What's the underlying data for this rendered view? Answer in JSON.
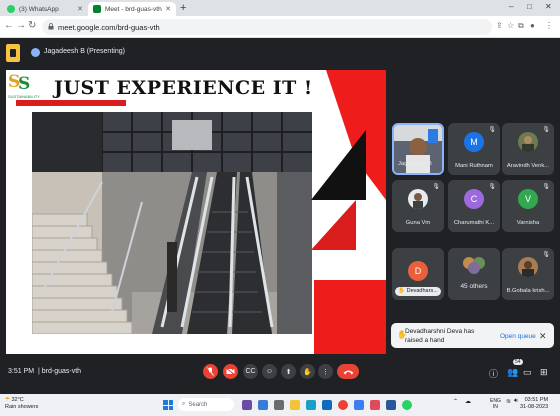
{
  "browser": {
    "tabs": [
      {
        "title": "(3) WhatsApp",
        "favicon_color": "#25d366",
        "active": false
      },
      {
        "title": "Meet - brd-guas-vth",
        "favicon_color": "#00832d",
        "active": true
      }
    ],
    "new_tab": "+",
    "minimize": "–",
    "maximize": "□",
    "close": "✕",
    "back": "←",
    "forward": "→",
    "reload": "↻",
    "url": "meet.google.com/brd-guas-vth",
    "lock": "🔒"
  },
  "meet_header": {
    "presenter": "Jagadeesh B (Presenting)"
  },
  "slide": {
    "title": "JUST EXPERIENCE IT !",
    "logo_text_1": "S",
    "logo_text_2": "S",
    "logo_sub": "SUSTAINABILITY",
    "accent": "#ef1c1c"
  },
  "participants": [
    {
      "name": "Jagadeesh B",
      "type": "video"
    },
    {
      "name": "Mani Ruthnam",
      "initial": "M",
      "color": "#1a73e8"
    },
    {
      "name": "Aravindh Venk...",
      "type": "photo"
    },
    {
      "name": "Guna Vm",
      "type": "photo"
    },
    {
      "name": "Charumathi K...",
      "initial": "C",
      "color": "#9c6ade"
    },
    {
      "name": "Varnisha",
      "initial": "V",
      "color": "#33a852"
    },
    {
      "name": "Devadhars...",
      "initial": "D",
      "color": "#e8603c",
      "type": "pill"
    },
    {
      "name": "45 others",
      "type": "group"
    },
    {
      "name": "B.Gobala krish...",
      "type": "photo"
    }
  ],
  "notification": {
    "message": "Devadharshni Deva has raised a hand",
    "action": "Open queue",
    "close": "✕"
  },
  "meet_footer": {
    "time": "3:51 PM",
    "separator": "|",
    "meeting_code": "brd-guas-vth",
    "participant_count": "54"
  },
  "taskbar": {
    "weather_temp": "32°C",
    "weather_desc": "Rain showers",
    "search_placeholder": "Search",
    "lang_1": "ENG",
    "lang_2": "IN",
    "clock_time": "03:51 PM",
    "clock_date": "31-08-2023"
  }
}
